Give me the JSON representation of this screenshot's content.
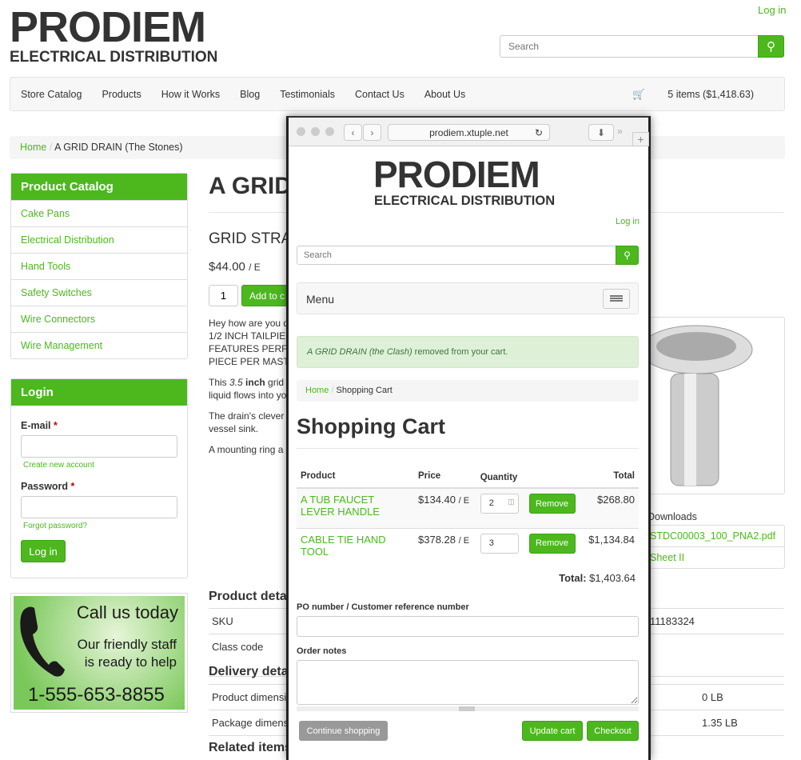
{
  "header": {
    "logo_main": "PRODIEM",
    "logo_sub": "ELECTRICAL DISTRIBUTION",
    "login": "Log in",
    "search_placeholder": "Search"
  },
  "nav": {
    "items": [
      "Store Catalog",
      "Products",
      "How it Works",
      "Blog",
      "Testimonials",
      "Contact Us",
      "About Us"
    ],
    "cart": "5 items ($1,418.63)"
  },
  "breadcrumb": {
    "home": "Home",
    "current": "A GRID DRAIN (The Stones)"
  },
  "sidebar": {
    "catalog_title": "Product Catalog",
    "items": [
      "Cake Pans",
      "Electrical Distribution",
      "Hand Tools",
      "Safety Switches",
      "Wire Connectors",
      "Wire Management"
    ],
    "login_title": "Login",
    "email_label": "E-mail",
    "password_label": "Password",
    "required": "*",
    "create_account": "Create new account",
    "forgot": "Forgot password?",
    "login_button": "Log in"
  },
  "banner": {
    "line1": "Call us today",
    "line2": "Our friendly staff",
    "line3": "is ready to help",
    "phone": "1-555-653-8855"
  },
  "product": {
    "title": "A GRID",
    "subtitle": "GRID STRA",
    "price": "$44.00",
    "unit": "/ E",
    "qty": "1",
    "add": "Add to c",
    "desc1": [
      "Hey how are you d",
      "1/2 INCH TAILPIEC",
      "FEATURES PERFO",
      "PIECE PER MAST"
    ],
    "desc2a": "This ",
    "desc2b": "3.5",
    "desc2c": " inch",
    "desc2d": " grid",
    "desc2e": "liquid flows into yo",
    "desc3": [
      "The drain's clever",
      "vessel sink."
    ],
    "desc4": "A mounting ring a",
    "details_title": "Product detail",
    "sku_label": "SKU",
    "sku": "11183324",
    "class_label": "Class code",
    "delivery_title": "Delivery detail",
    "prod_dim_label": "Product dimensio",
    "prod_dim": "0 LB",
    "pkg_dim_label": "Package dimensi",
    "pkg_dim": "1.35 LB",
    "related_title": "Related items",
    "downloads_title": "Downloads",
    "downloads": [
      "STDC00003_100_PNA2.pdf",
      "Sheet II"
    ]
  },
  "popup": {
    "url": "prodiem.xtuple.net",
    "logo_main": "PRODIEM",
    "logo_sub": "ELECTRICAL DISTRIBUTION",
    "login": "Log in",
    "search_placeholder": "Search",
    "menu": "Menu",
    "alert_italic": "A GRID DRAIN (the Clash)",
    "alert_rest": " removed from your cart.",
    "bc_home": "Home",
    "bc_current": "Shopping Cart",
    "title": "Shopping Cart",
    "headers": {
      "product": "Product",
      "price": "Price",
      "quantity": "Quantity",
      "total": "Total"
    },
    "rows": [
      {
        "name": "A TUB FAUCET LEVER HANDLE",
        "price": "$134.40",
        "unit": "/ E",
        "qty": "2",
        "remove": "Remove",
        "total": "$268.80"
      },
      {
        "name": "CABLE TIE HAND TOOL",
        "price": "$378.28",
        "unit": "/ E",
        "qty": "3",
        "remove": "Remove",
        "total": "$1,134.84"
      }
    ],
    "total_label": "Total:",
    "total": "$1,403.64",
    "po_label": "PO number / Customer reference number",
    "notes_label": "Order notes",
    "continue": "Continue shopping",
    "update": "Update cart",
    "checkout": "Checkout"
  },
  "colors": {
    "accent": "#4cb81e"
  }
}
